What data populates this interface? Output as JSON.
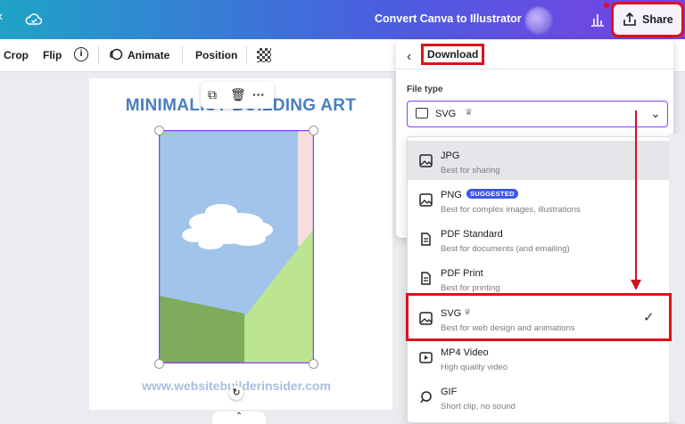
{
  "topbar": {
    "title": "Convert Canva to Illustrator",
    "share_label": "Share",
    "accent_start": "#1fa3c6",
    "accent_end": "#7a3fe4"
  },
  "toolbar": {
    "crop": "Crop",
    "flip": "Flip",
    "info": "i",
    "animate": "Animate",
    "position": "Position"
  },
  "canvas": {
    "art_title": "MINIMALIST BUILDING ART",
    "watermark": "www.websitebuilderinsider.com"
  },
  "download_panel": {
    "title": "Download",
    "file_type_label": "File type",
    "selected_value": "SVG",
    "highlight_color": "#e0101a",
    "options": [
      {
        "name": "JPG",
        "desc": "Best for sharing",
        "icon": "image-icon"
      },
      {
        "name": "PNG",
        "desc": "Best for complex images, illustrations",
        "badge": "SUGGESTED",
        "icon": "image-icon"
      },
      {
        "name": "PDF Standard",
        "desc": "Best for documents (and emailing)",
        "icon": "document-icon"
      },
      {
        "name": "PDF Print",
        "desc": "Best for printing",
        "icon": "document-icon"
      },
      {
        "name": "SVG",
        "desc": "Best for web design and animations",
        "icon": "image-icon",
        "premium": true,
        "selected": true
      },
      {
        "name": "MP4 Video",
        "desc": "High quality video",
        "icon": "video-icon"
      },
      {
        "name": "GIF",
        "desc": "Short clip, no sound",
        "icon": "gif-icon"
      }
    ]
  }
}
